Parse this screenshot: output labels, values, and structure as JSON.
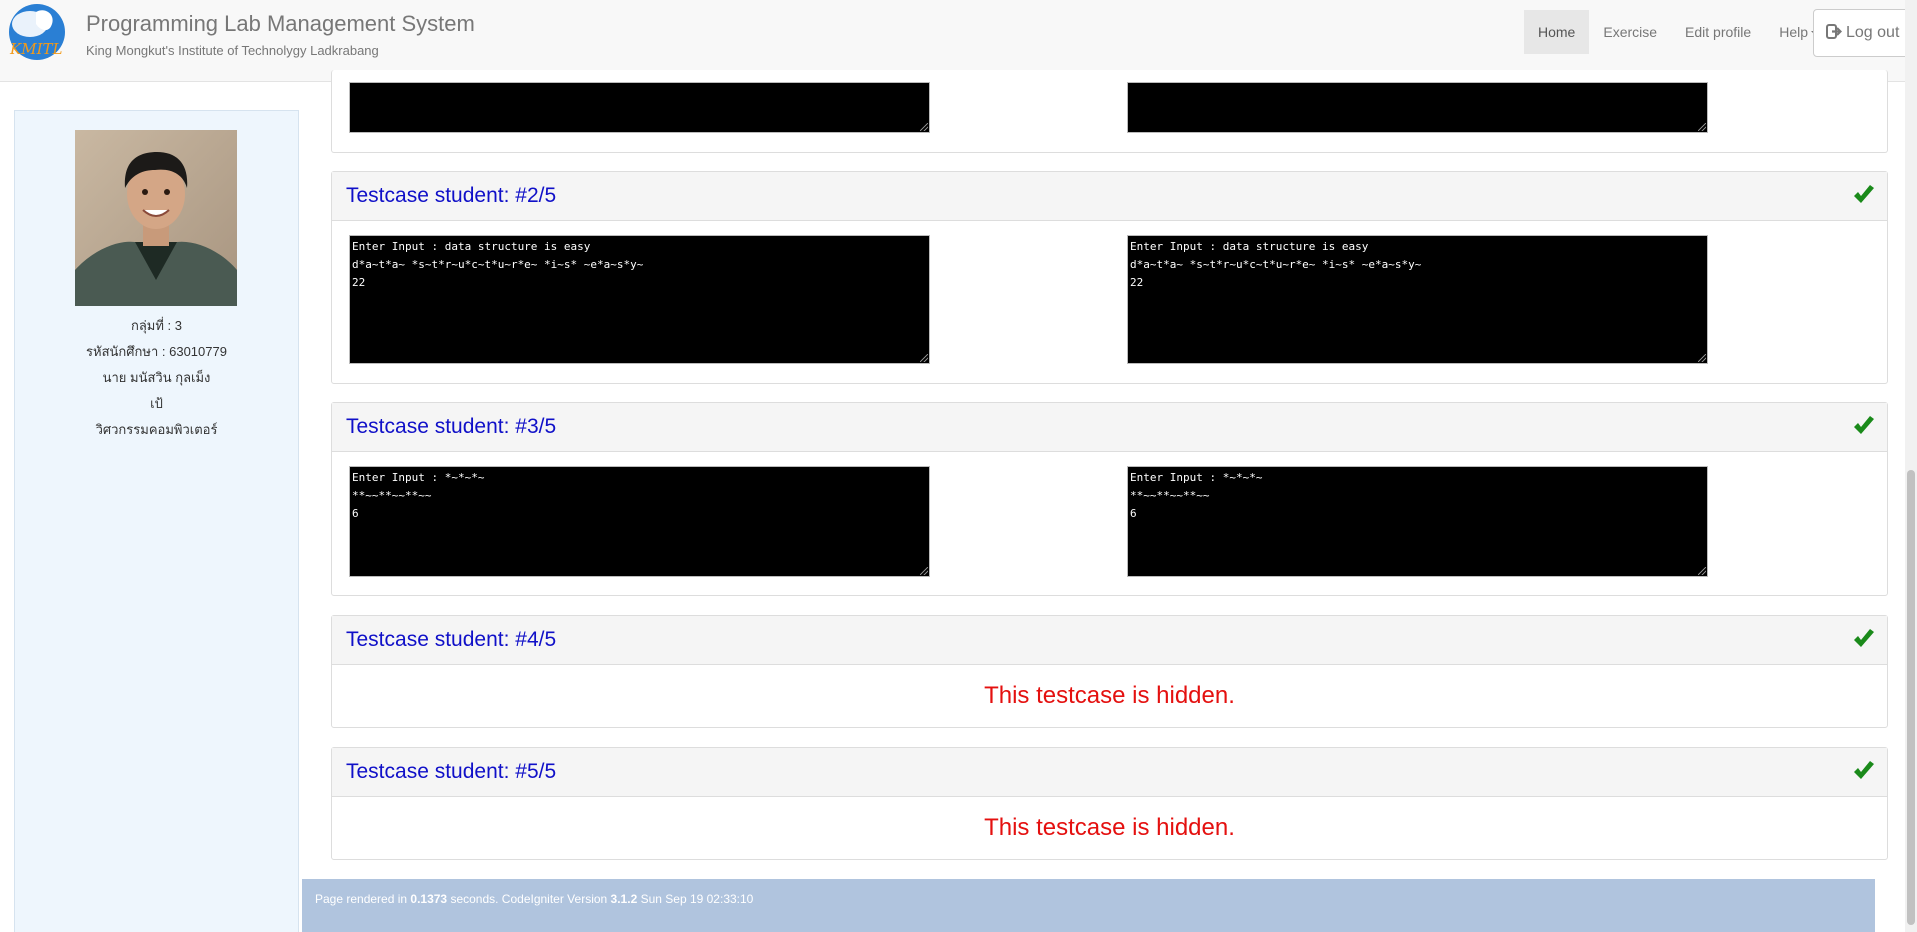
{
  "header": {
    "title": "Programming Lab Management System",
    "subtitle": "King Mongkut's Institute of Technolygy Ladkrabang",
    "logo_text": "KMITL",
    "nav": [
      {
        "label": "Home",
        "active": true
      },
      {
        "label": "Exercise"
      },
      {
        "label": "Edit profile"
      },
      {
        "label": "Help"
      }
    ],
    "logout_label": "Log out"
  },
  "sidebar": {
    "group": "กลุ่มที่ : 3",
    "student_id": "รหัสนักศึกษา : 63010779",
    "name": "นาย มนัสวิน กุลเม็ง",
    "nickname": "เป้",
    "department": "วิศวกรรมคอมพิวเตอร์"
  },
  "testcases": [
    {
      "title": "Testcase student: #2/5",
      "passed": true,
      "expected_output": "Enter Input : data structure is easy\nd*a~t*a~ *s~t*r~u*c~t*u~r*e~ *i~s* ~e*a~s*y~\n22",
      "student_output": "Enter Input : data structure is easy\nd*a~t*a~ *s~t*r~u*c~t*u~r*e~ *i~s* ~e*a~s*y~\n22"
    },
    {
      "title": "Testcase student: #3/5",
      "passed": true,
      "expected_output": "Enter Input : *~*~*~\n**~~**~~**~~\n6",
      "student_output": "Enter Input : *~*~*~\n**~~**~~**~~\n6"
    },
    {
      "title": "Testcase student: #4/5",
      "passed": true,
      "hidden_message": "This testcase is hidden."
    },
    {
      "title": "Testcase student: #5/5",
      "passed": true,
      "hidden_message": "This testcase is hidden."
    }
  ],
  "footer": {
    "prefix": "Page rendered in ",
    "time": "0.1373",
    "middle": " seconds. CodeIgniter Version ",
    "version": "3.1.2",
    "suffix": " Sun Sep 19 02:33:10"
  },
  "colors": {
    "title_blue": "#1010c8",
    "check_green": "#1a8a1a",
    "hidden_red": "#e4100f",
    "footer_bg": "#b0c4de"
  }
}
